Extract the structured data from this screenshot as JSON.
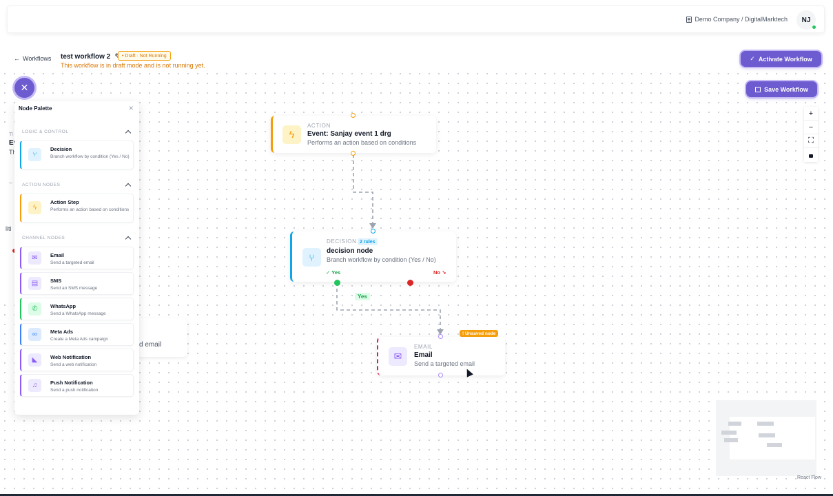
{
  "topbar": {
    "company": "Demo Company / DigitalMarktech",
    "avatar_initials": "NJ"
  },
  "header": {
    "back_label": "Workflows",
    "workflow_name": "test workflow 2",
    "status_badge": "• Draft · Not Running",
    "draft_message": "This workflow is in draft mode and is not running yet.",
    "activate_label": "Activate Workflow",
    "save_label": "Save Workflow"
  },
  "background": {
    "panel_fragments": [
      "Tl",
      "Ev",
      "Th",
      "–",
      "liti"
    ],
    "hidden_node_desc": "d email"
  },
  "palette": {
    "title": "Node Palette",
    "sections": [
      {
        "label": "LOGIC & CONTROL",
        "items": [
          {
            "name": "Decision",
            "desc": "Branch workflow by condition (Yes / No)",
            "color": "#0ea5e9",
            "icon": "branch-icon"
          }
        ]
      },
      {
        "label": "ACTION NODES",
        "items": [
          {
            "name": "Action Step",
            "desc": "Performs an action based on conditions",
            "color": "#f59e0b",
            "icon": "bolt-icon"
          }
        ]
      },
      {
        "label": "CHANNEL NODES",
        "items": [
          {
            "name": "Email",
            "desc": "Send a targeted email",
            "color": "#8b5cf6",
            "icon": "mail-icon"
          },
          {
            "name": "SMS",
            "desc": "Send an SMS message",
            "color": "#8b5cf6",
            "icon": "chat-icon"
          },
          {
            "name": "WhatsApp",
            "desc": "Send a WhatsApp message",
            "color": "#22c55e",
            "icon": "whatsapp-icon"
          },
          {
            "name": "Meta Ads",
            "desc": "Create a Meta Ads campaign",
            "color": "#3b82f6",
            "icon": "meta-icon"
          },
          {
            "name": "Web Notification",
            "desc": "Send a web notification",
            "color": "#8b5cf6",
            "icon": "megaphone-icon"
          },
          {
            "name": "Push Notification",
            "desc": "Send a push notification",
            "color": "#8b5cf6",
            "icon": "bell-icon"
          }
        ]
      }
    ]
  },
  "nodes": {
    "action": {
      "type": "ACTION",
      "name": "Event: Sanjay event 1 drg",
      "desc": "Performs an action based on conditions"
    },
    "decision": {
      "type": "DECISION",
      "rules": "2 rules",
      "name": "decision node",
      "desc": "Branch workflow by condition (Yes / No)",
      "yes": "✓ Yes",
      "no": "No ↘"
    },
    "email": {
      "type": "EMAIL",
      "name": "Email",
      "desc": "Send a targeted email",
      "badge": "! Unsaved node"
    }
  },
  "edge_label": "Yes",
  "zoom": {
    "in": "+",
    "out": "−"
  },
  "credit": "React Flow",
  "colors": {
    "accent": "#6d5bd0",
    "action": "#f59e0b",
    "decision": "#0ea5e9",
    "email": "#8b5cf6",
    "yes": "#16a34a",
    "no": "#dc2626",
    "unsaved": "#e11d48"
  }
}
